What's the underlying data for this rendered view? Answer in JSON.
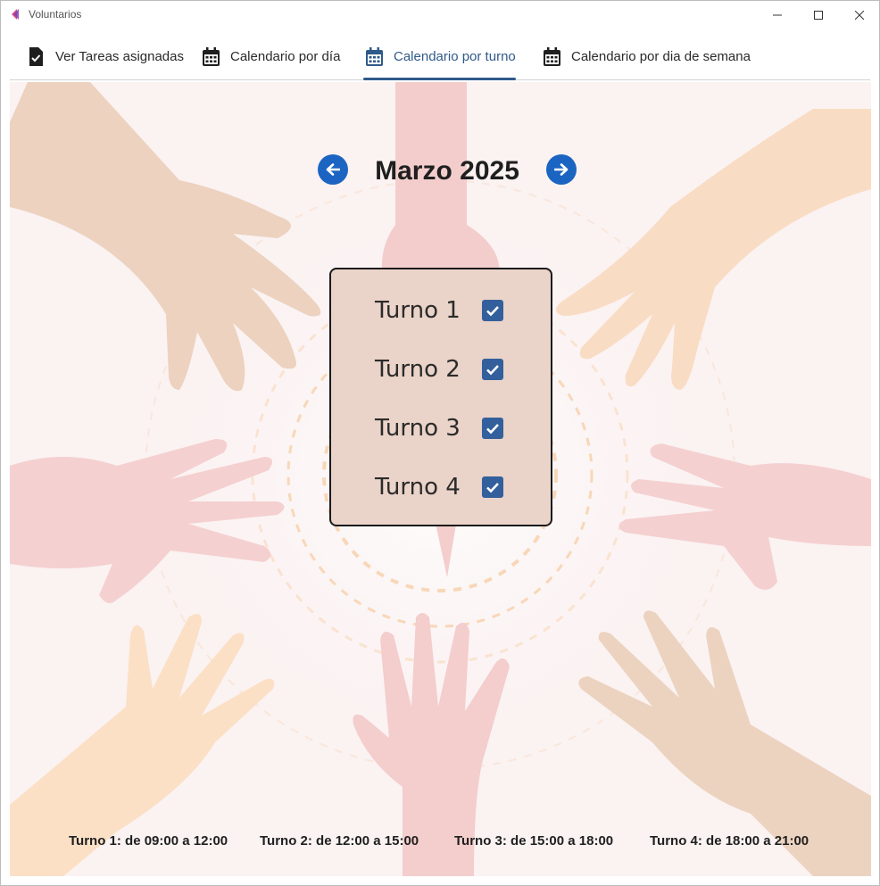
{
  "window": {
    "title": "Voluntarios",
    "icons": {
      "logo": "app-logo",
      "minimize": "minimize-icon",
      "maximize": "maximize-icon",
      "close": "close-icon"
    }
  },
  "tabs": [
    {
      "label": "Ver Tareas asignadas",
      "icon": "task-check-icon",
      "active": false
    },
    {
      "label": "Calendario por día",
      "icon": "calendar-icon",
      "active": false
    },
    {
      "label": "Calendario por turno",
      "icon": "calendar-icon",
      "active": true
    },
    {
      "label": "Calendario por dia de semana",
      "icon": "calendar-icon",
      "active": false
    }
  ],
  "calendar": {
    "month_title": "Marzo 2025",
    "prev_icon": "arrow-left-icon",
    "next_icon": "arrow-right-icon"
  },
  "shifts": [
    {
      "label": "Turno 1",
      "checked": true
    },
    {
      "label": "Turno 2",
      "checked": true
    },
    {
      "label": "Turno 3",
      "checked": true
    },
    {
      "label": "Turno 4",
      "checked": true
    }
  ],
  "legend": [
    "Turno 1: de 09:00 a 12:00",
    "Turno 2: de 12:00 a 15:00",
    "Turno 3: de 15:00 a 18:00",
    "Turno 4: de 18:00 a 21:00"
  ],
  "colors": {
    "accent": "#2f5a8a",
    "nav_button": "#1b64c2",
    "checkbox": "#33609c",
    "panel_bg": "#ead3c8",
    "content_bg": "#fbf3f3"
  }
}
